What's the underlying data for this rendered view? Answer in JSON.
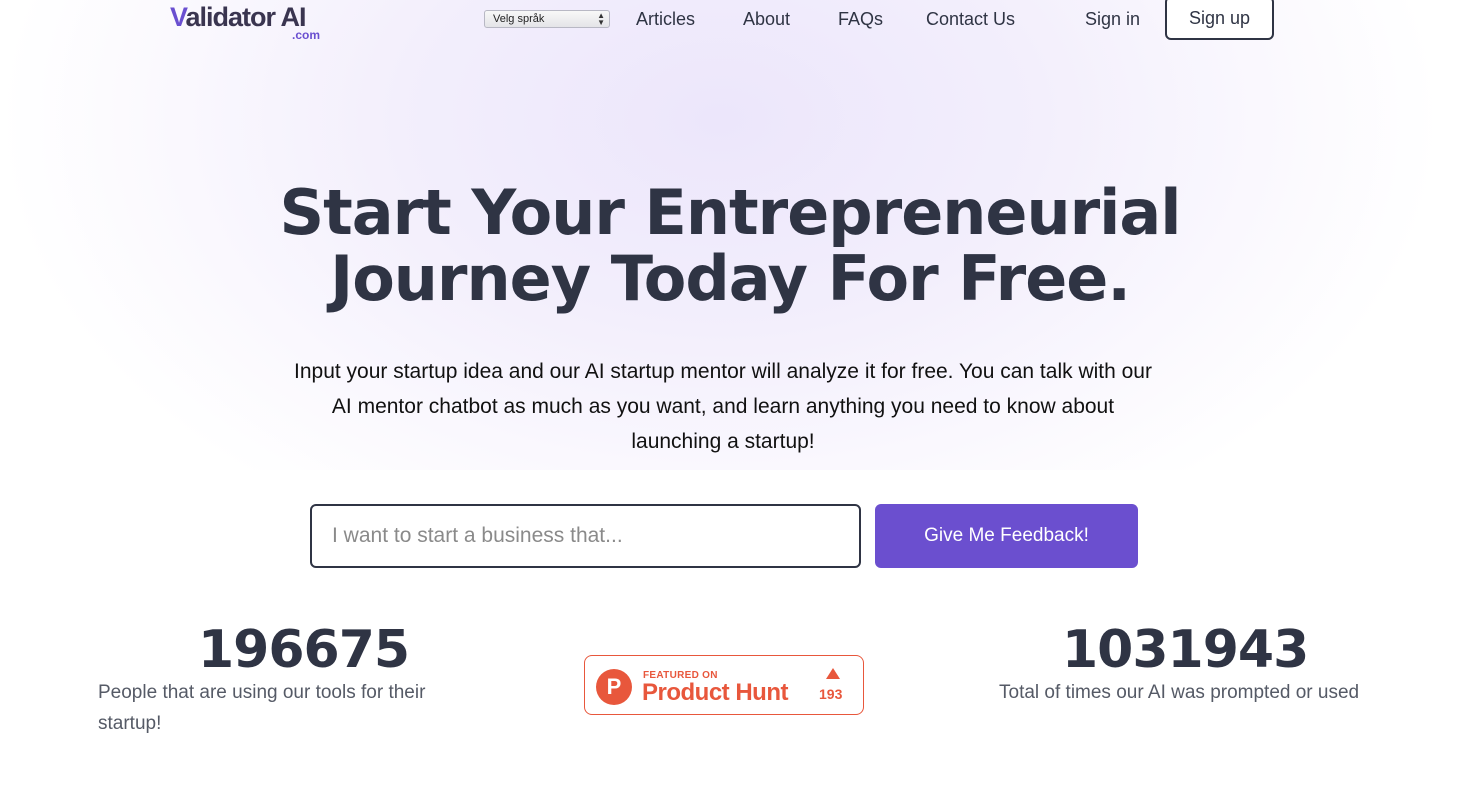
{
  "nav": {
    "logo_main": "alidator AI",
    "logo_v": "V",
    "logo_sub": ".com",
    "language_select": "Velg språk",
    "links": [
      "Articles",
      "About",
      "FAQs",
      "Contact Us"
    ],
    "sign_in": "Sign in",
    "sign_up": "Sign up"
  },
  "hero": {
    "title_line1": "Start Your Entrepreneurial",
    "title_line2": "Journey Today For Free.",
    "description": "Input your startup idea and our AI startup mentor will analyze it for free. You can talk with our AI mentor chatbot as much as you want, and learn anything you need to know about launching a startup!",
    "input_placeholder": "I want to start a business that...",
    "input_value": "",
    "button": "Give Me Feedback!"
  },
  "stats": {
    "users_count": "196675",
    "users_label": "People that are using our tools for their startup!",
    "prompts_count": "1031943",
    "prompts_label": "Total of times our AI was prompted or used"
  },
  "product_hunt": {
    "logo_letter": "P",
    "featured": "FEATURED ON",
    "name": "Product Hunt",
    "votes": "193"
  },
  "colors": {
    "accent": "#6b4fcf",
    "text": "#2f3444",
    "product_hunt": "#e8573c"
  }
}
